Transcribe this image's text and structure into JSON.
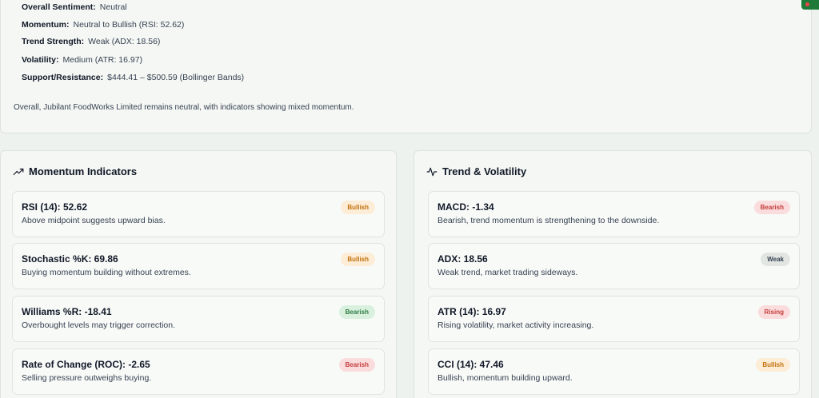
{
  "summary": {
    "sentiment_label": "Overall Sentiment:",
    "sentiment_value": "Neutral",
    "momentum_label": "Momentum:",
    "momentum_value": "Neutral to Bullish (RSI: 52.62)",
    "trend_label": "Trend Strength:",
    "trend_value": "Weak (ADX: 18.56)",
    "volatility_label": "Volatility:",
    "volatility_value": "Medium (ATR: 16.97)",
    "sr_label": "Support/Resistance:",
    "sr_value": "$444.41 – $500.59 (Bollinger Bands)",
    "note": "Overall, Jubilant FoodWorks Limited remains neutral, with indicators showing mixed momentum."
  },
  "momentum_panel": {
    "title": "Momentum Indicators",
    "icon": "trending-up-icon",
    "items": [
      {
        "name": "RSI (14): 52.62",
        "desc": "Above midpoint suggests upward bias.",
        "badge": "Bullish",
        "badge_color": "#c2710c"
      },
      {
        "name": "Stochastic %K: 69.86",
        "desc": "Buying momentum building without extremes.",
        "badge": "Bullish",
        "badge_color": "#c2710c"
      },
      {
        "name": "Williams %R: -18.41",
        "desc": "Overbought levels may trigger correction.",
        "badge": "Bearish",
        "badge_color": "#2f7a44"
      },
      {
        "name": "Rate of Change (ROC): -2.65",
        "desc": "Selling pressure outweighs buying.",
        "badge": "Bearish",
        "badge_color": "#c43b3b"
      }
    ]
  },
  "trend_panel": {
    "title": "Trend & Volatility",
    "icon": "activity-icon",
    "items": [
      {
        "name": "MACD: -1.34",
        "desc": "Bearish, trend momentum is strengthening to the downside.",
        "badge": "Bearish",
        "badge_color": "#c43b3b"
      },
      {
        "name": "ADX: 18.56",
        "desc": "Weak trend, market trading sideways.",
        "badge": "Weak",
        "badge_color": "#374151"
      },
      {
        "name": "ATR (14): 16.97",
        "desc": "Rising volatility, market activity increasing.",
        "badge": "Rising",
        "badge_color": "#c43b3b"
      },
      {
        "name": "CCI (14): 47.46",
        "desc": "Bullish, momentum building upward.",
        "badge": "Bullish",
        "badge_color": "#c2710c"
      }
    ]
  }
}
